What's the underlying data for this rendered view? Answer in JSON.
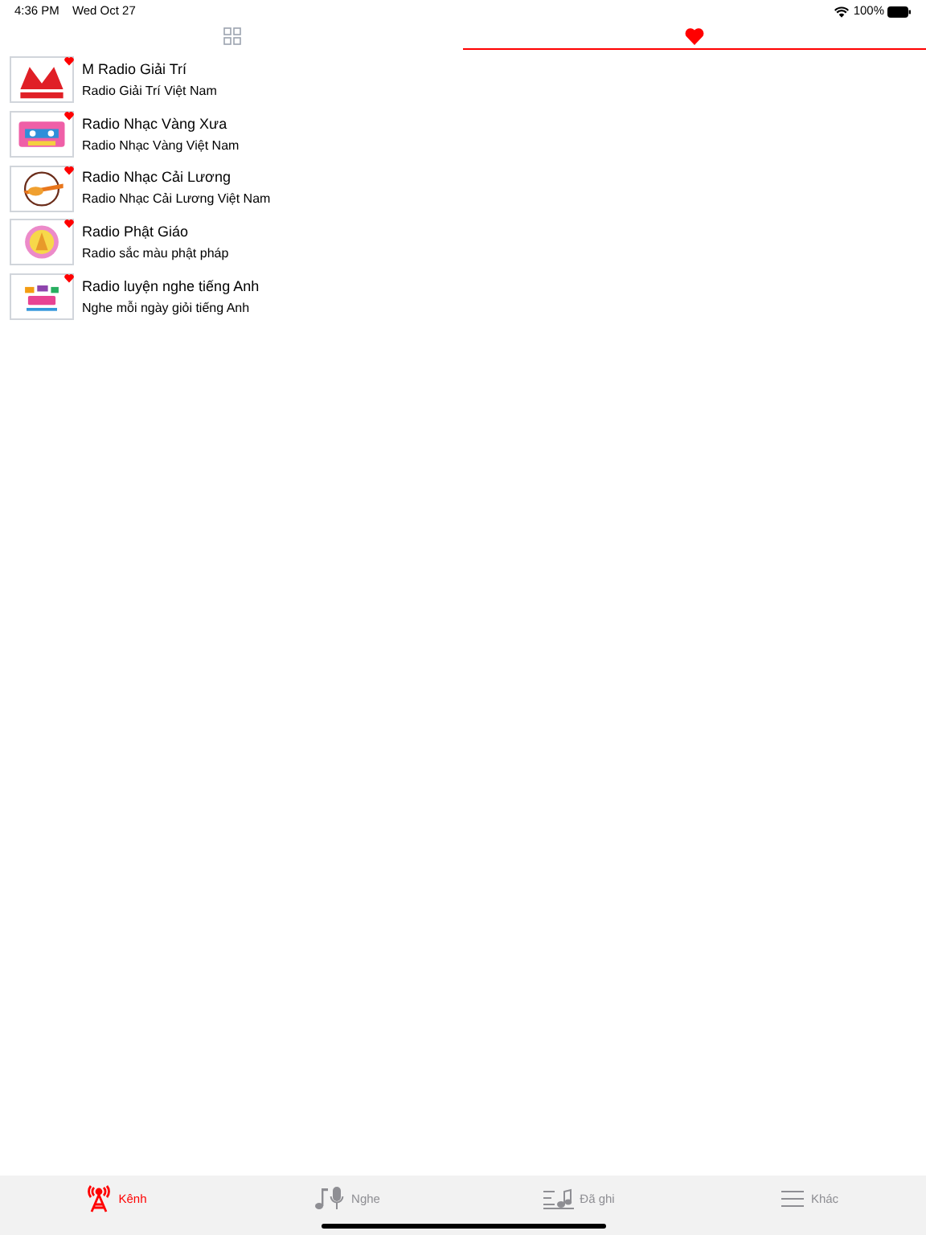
{
  "status_bar": {
    "time": "4:36 PM",
    "date": "Wed Oct 27",
    "battery": "100%"
  },
  "top_tabs": [
    {
      "kind": "grid",
      "selected": false
    },
    {
      "kind": "heart",
      "selected": true
    }
  ],
  "stations": [
    {
      "title": "M Radio Giải Trí",
      "subtitle": "Radio Giải Trí Việt Nam",
      "favorite": true
    },
    {
      "title": "Radio Nhạc Vàng Xưa",
      "subtitle": "Radio Nhạc Vàng Việt Nam",
      "favorite": true
    },
    {
      "title": "Radio Nhạc Cải Lương",
      "subtitle": "Radio Nhạc Cải Lương Việt Nam",
      "favorite": true
    },
    {
      "title": "Radio Phật Giáo",
      "subtitle": "Radio sắc màu phật pháp",
      "favorite": true
    },
    {
      "title": "Radio luyện nghe tiếng Anh",
      "subtitle": "Nghe mỗi ngày giỏi tiếng Anh",
      "favorite": true
    }
  ],
  "tab_bar": [
    {
      "kind": "antenna",
      "label": "Kênh",
      "selected": true
    },
    {
      "kind": "music-mic",
      "label": "Nghe",
      "selected": false
    },
    {
      "kind": "recorded",
      "label": "Đã ghi",
      "selected": false
    },
    {
      "kind": "menu",
      "label": "Khác",
      "selected": false
    }
  ]
}
